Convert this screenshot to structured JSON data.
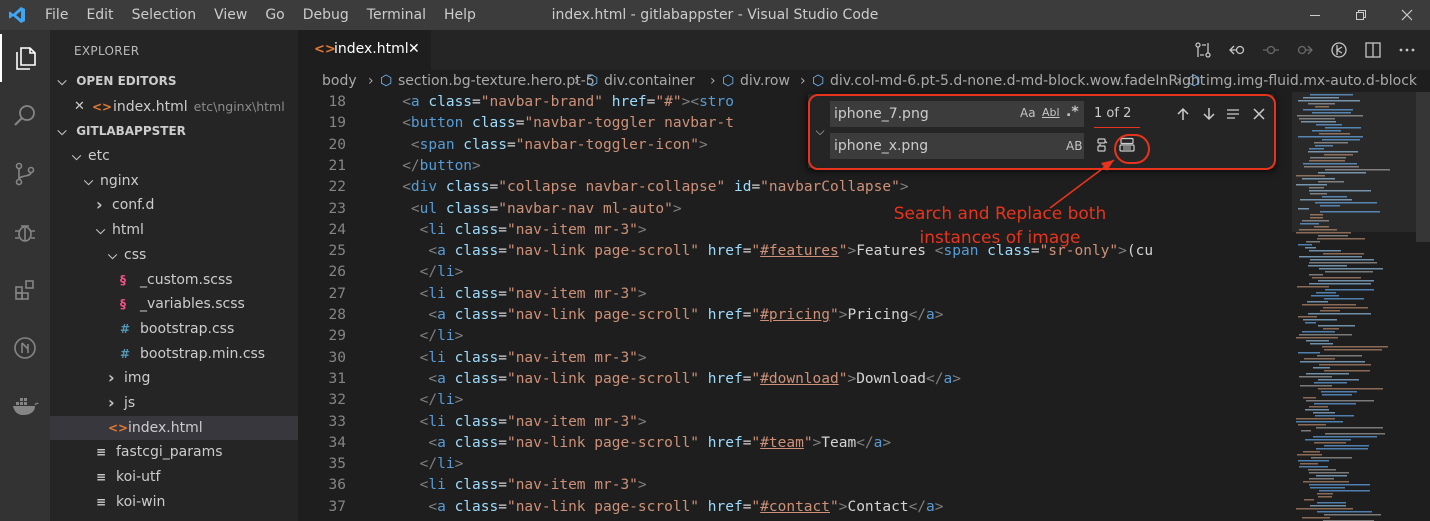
{
  "titlebar": {
    "menu": [
      "File",
      "Edit",
      "Selection",
      "View",
      "Go",
      "Debug",
      "Terminal",
      "Help"
    ],
    "title": "index.html - gitlabappster - Visual Studio Code",
    "accent": "#0078d4"
  },
  "sidebar": {
    "title": "EXPLORER",
    "open_editors_label": "OPEN EDITORS",
    "open_editor": {
      "name": "index.html",
      "path": "etc\\nginx\\html"
    },
    "project_label": "GITLABAPPSTER",
    "tree": [
      {
        "label": "etc",
        "kind": "folder-open",
        "depth": 0
      },
      {
        "label": "nginx",
        "kind": "folder-open",
        "depth": 1
      },
      {
        "label": "conf.d",
        "kind": "folder",
        "depth": 2
      },
      {
        "label": "html",
        "kind": "folder-open",
        "depth": 2
      },
      {
        "label": "css",
        "kind": "folder-open",
        "depth": 3
      },
      {
        "label": "_custom.scss",
        "kind": "scss",
        "depth": 4
      },
      {
        "label": "_variables.scss",
        "kind": "scss",
        "depth": 4
      },
      {
        "label": "bootstrap.css",
        "kind": "css",
        "depth": 4
      },
      {
        "label": "bootstrap.min.css",
        "kind": "css",
        "depth": 4
      },
      {
        "label": "img",
        "kind": "folder",
        "depth": 3
      },
      {
        "label": "js",
        "kind": "folder",
        "depth": 3
      },
      {
        "label": "index.html",
        "kind": "html",
        "depth": 3,
        "selected": true
      },
      {
        "label": "fastcgi_params",
        "kind": "text",
        "depth": 2
      },
      {
        "label": "koi-utf",
        "kind": "text",
        "depth": 2
      },
      {
        "label": "koi-win",
        "kind": "text",
        "depth": 2
      }
    ]
  },
  "tab": {
    "label": "index.html",
    "icon": "<>",
    "close": "✕"
  },
  "breadcrumb": [
    "body",
    "section.bg-texture.hero.pt-5",
    "div.container",
    "div.row",
    "div.col-md-6.pt-5.d-none.d-md-block.wow.fadeInRight",
    "img.img-fluid.mx-auto.d-block"
  ],
  "editor": {
    "lines": [
      {
        "n": "18",
        "indent": 6,
        "tokens": [
          [
            "b",
            "<"
          ],
          [
            "t",
            "a"
          ],
          [
            "x",
            " "
          ],
          [
            "a",
            "class"
          ],
          [
            "x",
            "="
          ],
          [
            "s",
            "\"navbar-brand\""
          ],
          [
            "x",
            " "
          ],
          [
            "a",
            "href"
          ],
          [
            "x",
            "="
          ],
          [
            "s",
            "\"#\""
          ],
          [
            "b",
            ">"
          ],
          [
            "b",
            "<"
          ],
          [
            "t",
            "stro"
          ]
        ]
      },
      {
        "n": "19",
        "indent": 6,
        "tokens": [
          [
            "b",
            "<"
          ],
          [
            "t",
            "button"
          ],
          [
            "x",
            " "
          ],
          [
            "a",
            "class"
          ],
          [
            "x",
            "="
          ],
          [
            "s",
            "\"navbar-toggler navbar-t"
          ]
        ]
      },
      {
        "n": "20",
        "indent": 8,
        "tokens": [
          [
            "b",
            "<"
          ],
          [
            "t",
            "span"
          ],
          [
            "x",
            " "
          ],
          [
            "a",
            "class"
          ],
          [
            "x",
            "="
          ],
          [
            "s",
            "\"navbar-toggler-icon\""
          ],
          [
            "b",
            ">"
          ]
        ]
      },
      {
        "n": "21",
        "indent": 6,
        "tokens": [
          [
            "b",
            "</"
          ],
          [
            "t",
            "button"
          ],
          [
            "b",
            ">"
          ]
        ]
      },
      {
        "n": "22",
        "indent": 6,
        "tokens": [
          [
            "b",
            "<"
          ],
          [
            "t",
            "div"
          ],
          [
            "x",
            " "
          ],
          [
            "a",
            "class"
          ],
          [
            "x",
            "="
          ],
          [
            "s",
            "\"collapse navbar-collapse\""
          ],
          [
            "x",
            " "
          ],
          [
            "a",
            "id"
          ],
          [
            "x",
            "="
          ],
          [
            "s",
            "\"navbarCollapse\""
          ],
          [
            "b",
            ">"
          ]
        ]
      },
      {
        "n": "23",
        "indent": 8,
        "tokens": [
          [
            "b",
            "<"
          ],
          [
            "t",
            "ul"
          ],
          [
            "x",
            " "
          ],
          [
            "a",
            "class"
          ],
          [
            "x",
            "="
          ],
          [
            "s",
            "\"navbar-nav ml-auto\""
          ],
          [
            "b",
            ">"
          ]
        ]
      },
      {
        "n": "24",
        "indent": 10,
        "tokens": [
          [
            "b",
            "<"
          ],
          [
            "t",
            "li"
          ],
          [
            "x",
            " "
          ],
          [
            "a",
            "class"
          ],
          [
            "x",
            "="
          ],
          [
            "s",
            "\"nav-item mr-3\""
          ],
          [
            "b",
            ">"
          ]
        ]
      },
      {
        "n": "25",
        "indent": 12,
        "tokens": [
          [
            "b",
            "<"
          ],
          [
            "t",
            "a"
          ],
          [
            "x",
            " "
          ],
          [
            "a",
            "class"
          ],
          [
            "x",
            "="
          ],
          [
            "s",
            "\"nav-link page-scroll\""
          ],
          [
            "x",
            " "
          ],
          [
            "a",
            "href"
          ],
          [
            "x",
            "="
          ],
          [
            "s",
            "\""
          ],
          [
            "su",
            "#features"
          ],
          [
            "s",
            "\""
          ],
          [
            "b",
            ">"
          ],
          [
            "x",
            "Features "
          ],
          [
            "b",
            "<"
          ],
          [
            "t",
            "span"
          ],
          [
            "x",
            " "
          ],
          [
            "a",
            "class"
          ],
          [
            "x",
            "="
          ],
          [
            "s",
            "\"sr-only\""
          ],
          [
            "b",
            ">"
          ],
          [
            "x",
            "(cu"
          ]
        ]
      },
      {
        "n": "26",
        "indent": 10,
        "tokens": [
          [
            "b",
            "</"
          ],
          [
            "t",
            "li"
          ],
          [
            "b",
            ">"
          ]
        ]
      },
      {
        "n": "27",
        "indent": 10,
        "tokens": [
          [
            "b",
            "<"
          ],
          [
            "t",
            "li"
          ],
          [
            "x",
            " "
          ],
          [
            "a",
            "class"
          ],
          [
            "x",
            "="
          ],
          [
            "s",
            "\"nav-item mr-3\""
          ],
          [
            "b",
            ">"
          ]
        ]
      },
      {
        "n": "28",
        "indent": 12,
        "tokens": [
          [
            "b",
            "<"
          ],
          [
            "t",
            "a"
          ],
          [
            "x",
            " "
          ],
          [
            "a",
            "class"
          ],
          [
            "x",
            "="
          ],
          [
            "s",
            "\"nav-link page-scroll\""
          ],
          [
            "x",
            " "
          ],
          [
            "a",
            "href"
          ],
          [
            "x",
            "="
          ],
          [
            "s",
            "\""
          ],
          [
            "su",
            "#pricing"
          ],
          [
            "s",
            "\""
          ],
          [
            "b",
            ">"
          ],
          [
            "x",
            "Pricing"
          ],
          [
            "b",
            "</"
          ],
          [
            "t",
            "a"
          ],
          [
            "b",
            ">"
          ]
        ]
      },
      {
        "n": "29",
        "indent": 10,
        "tokens": [
          [
            "b",
            "</"
          ],
          [
            "t",
            "li"
          ],
          [
            "b",
            ">"
          ]
        ]
      },
      {
        "n": "30",
        "indent": 10,
        "tokens": [
          [
            "b",
            "<"
          ],
          [
            "t",
            "li"
          ],
          [
            "x",
            " "
          ],
          [
            "a",
            "class"
          ],
          [
            "x",
            "="
          ],
          [
            "s",
            "\"nav-item mr-3\""
          ],
          [
            "b",
            ">"
          ]
        ]
      },
      {
        "n": "31",
        "indent": 12,
        "tokens": [
          [
            "b",
            "<"
          ],
          [
            "t",
            "a"
          ],
          [
            "x",
            " "
          ],
          [
            "a",
            "class"
          ],
          [
            "x",
            "="
          ],
          [
            "s",
            "\"nav-link page-scroll\""
          ],
          [
            "x",
            " "
          ],
          [
            "a",
            "href"
          ],
          [
            "x",
            "="
          ],
          [
            "s",
            "\""
          ],
          [
            "su",
            "#download"
          ],
          [
            "s",
            "\""
          ],
          [
            "b",
            ">"
          ],
          [
            "x",
            "Download"
          ],
          [
            "b",
            "</"
          ],
          [
            "t",
            "a"
          ],
          [
            "b",
            ">"
          ]
        ]
      },
      {
        "n": "32",
        "indent": 10,
        "tokens": [
          [
            "b",
            "</"
          ],
          [
            "t",
            "li"
          ],
          [
            "b",
            ">"
          ]
        ]
      },
      {
        "n": "33",
        "indent": 10,
        "tokens": [
          [
            "b",
            "<"
          ],
          [
            "t",
            "li"
          ],
          [
            "x",
            " "
          ],
          [
            "a",
            "class"
          ],
          [
            "x",
            "="
          ],
          [
            "s",
            "\"nav-item mr-3\""
          ],
          [
            "b",
            ">"
          ]
        ]
      },
      {
        "n": "34",
        "indent": 12,
        "tokens": [
          [
            "b",
            "<"
          ],
          [
            "t",
            "a"
          ],
          [
            "x",
            " "
          ],
          [
            "a",
            "class"
          ],
          [
            "x",
            "="
          ],
          [
            "s",
            "\"nav-link page-scroll\""
          ],
          [
            "x",
            " "
          ],
          [
            "a",
            "href"
          ],
          [
            "x",
            "="
          ],
          [
            "s",
            "\""
          ],
          [
            "su",
            "#team"
          ],
          [
            "s",
            "\""
          ],
          [
            "b",
            ">"
          ],
          [
            "x",
            "Team"
          ],
          [
            "b",
            "</"
          ],
          [
            "t",
            "a"
          ],
          [
            "b",
            ">"
          ]
        ]
      },
      {
        "n": "35",
        "indent": 10,
        "tokens": [
          [
            "b",
            "</"
          ],
          [
            "t",
            "li"
          ],
          [
            "b",
            ">"
          ]
        ]
      },
      {
        "n": "36",
        "indent": 10,
        "tokens": [
          [
            "b",
            "<"
          ],
          [
            "t",
            "li"
          ],
          [
            "x",
            " "
          ],
          [
            "a",
            "class"
          ],
          [
            "x",
            "="
          ],
          [
            "s",
            "\"nav-item mr-3\""
          ],
          [
            "b",
            ">"
          ]
        ]
      },
      {
        "n": "37",
        "indent": 12,
        "tokens": [
          [
            "b",
            "<"
          ],
          [
            "t",
            "a"
          ],
          [
            "x",
            " "
          ],
          [
            "a",
            "class"
          ],
          [
            "x",
            "="
          ],
          [
            "s",
            "\"nav-link page-scroll\""
          ],
          [
            "x",
            " "
          ],
          [
            "a",
            "href"
          ],
          [
            "x",
            "="
          ],
          [
            "s",
            "\""
          ],
          [
            "su",
            "#contact"
          ],
          [
            "s",
            "\""
          ],
          [
            "b",
            ">"
          ],
          [
            "x",
            "Contact"
          ],
          [
            "b",
            "</"
          ],
          [
            "t",
            "a"
          ],
          [
            "b",
            ">"
          ]
        ]
      }
    ]
  },
  "find": {
    "find_value": "iphone_7.png",
    "replace_value": "iphone_x.png",
    "match_case": "Aa",
    "whole_word": "Abl",
    "regex": ".*",
    "preserve_case": "AB",
    "result": "1 of 2"
  },
  "annotation": {
    "text": "Search and Replace both instances of image",
    "color": "#e8341c"
  }
}
